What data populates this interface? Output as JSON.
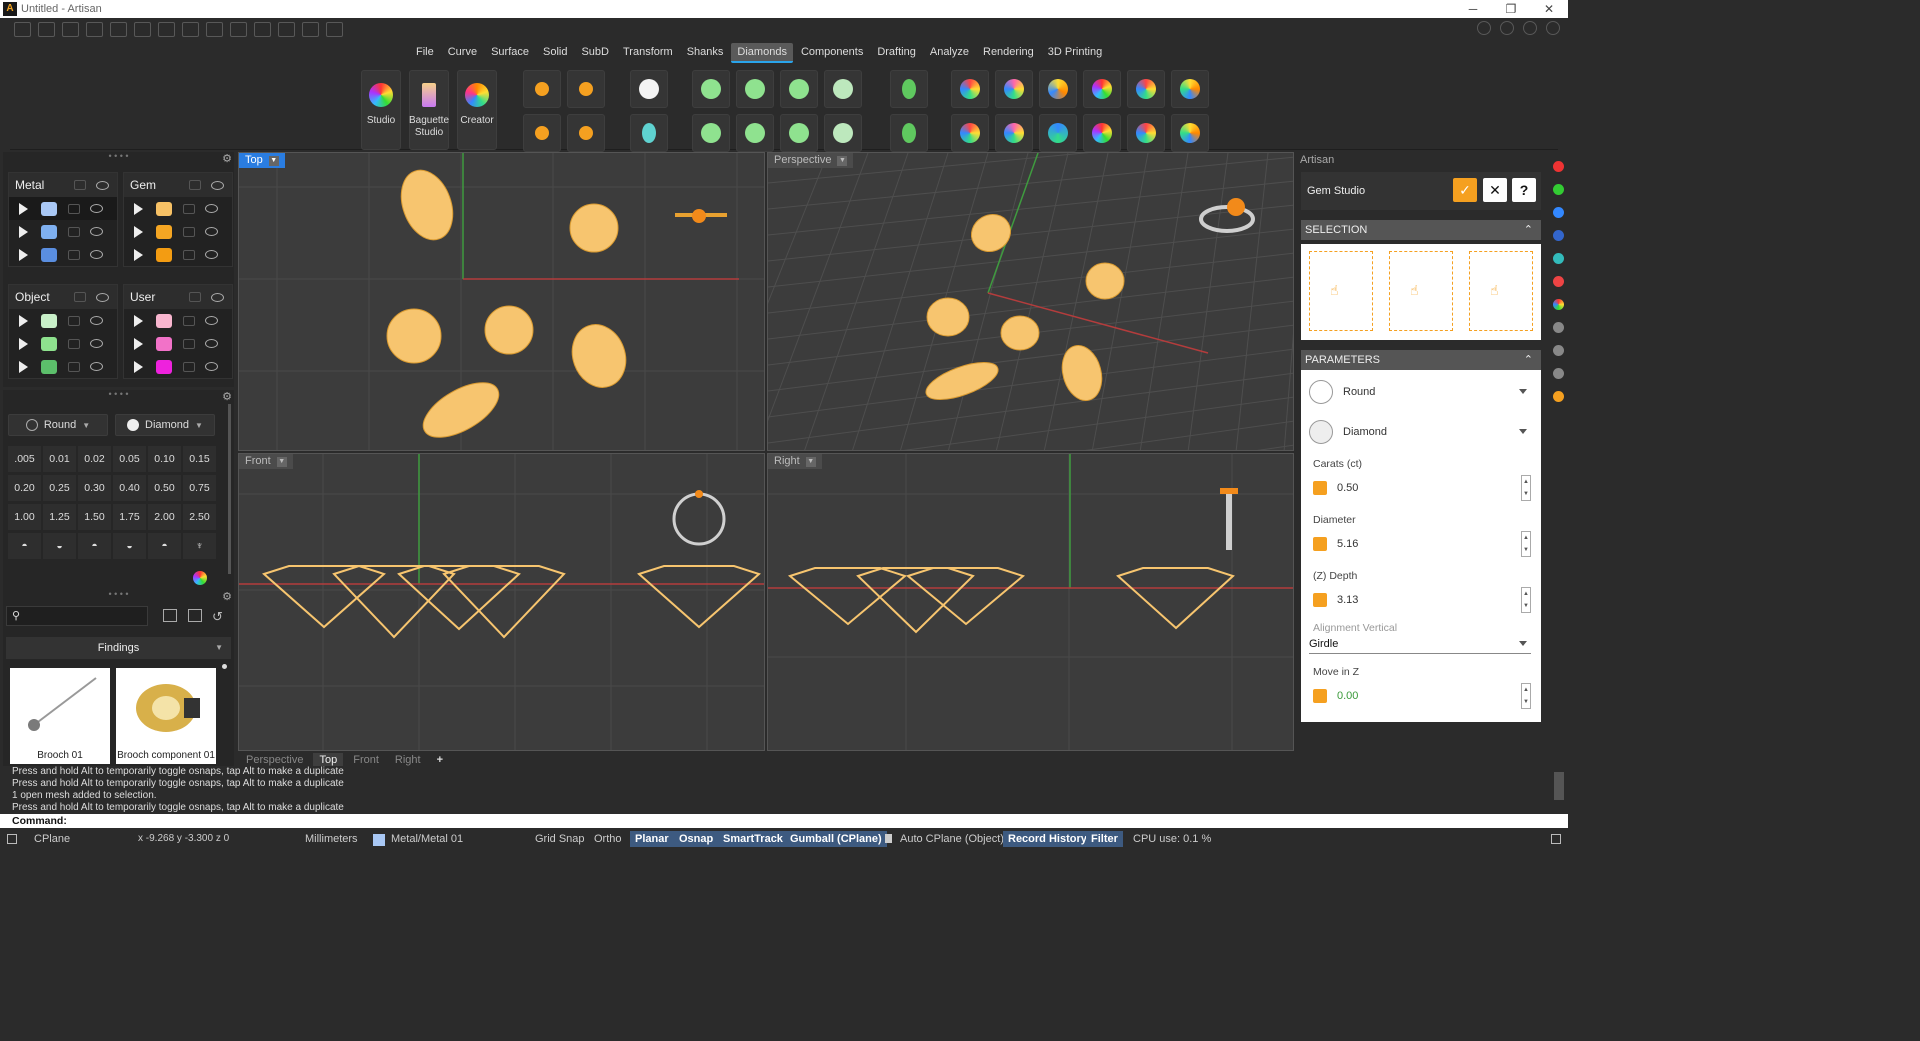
{
  "window": {
    "title": "Untitled - Artisan",
    "app_icon": "artisan-logo-icon"
  },
  "menu": {
    "items": [
      "File",
      "Curve",
      "Surface",
      "Solid",
      "SubD",
      "Transform",
      "Shanks",
      "Diamonds",
      "Components",
      "Drafting",
      "Analyze",
      "Rendering",
      "3D Printing"
    ],
    "active": "Diamonds"
  },
  "ribbon": {
    "big_buttons": [
      {
        "label": "Studio",
        "icon": "color-wheel-icon"
      },
      {
        "label": "Baguette Studio",
        "icon": "baguette-icon"
      },
      {
        "label": "Creator",
        "icon": "creator-icon"
      }
    ]
  },
  "layers": {
    "groups": [
      {
        "name": "Metal",
        "swatches": [
          "#a9c8f5",
          "#7fb0f0",
          "#5a8ee0"
        ]
      },
      {
        "name": "Gem",
        "swatches": [
          "#f7c165",
          "#f5a623",
          "#f39c12"
        ]
      },
      {
        "name": "Object",
        "swatches": [
          "#c9f0c9",
          "#8ee28e",
          "#5cbf6b"
        ]
      },
      {
        "name": "User",
        "swatches": [
          "#f9b6cf",
          "#f272c8",
          "#ee22dd"
        ]
      }
    ]
  },
  "gem_picker": {
    "shape": "Round",
    "material": "Diamond",
    "carats": [
      ".005",
      "0.01",
      "0.02",
      "0.05",
      "0.10",
      "0.15",
      "0.20",
      "0.25",
      "0.30",
      "0.40",
      "0.50",
      "0.75",
      "1.00",
      "1.25",
      "1.50",
      "1.75",
      "2.00",
      "2.50"
    ]
  },
  "library": {
    "search_placeholder": "",
    "category": "Findings",
    "items": [
      {
        "label": "Brooch 01"
      },
      {
        "label": "Brooch component 01"
      }
    ]
  },
  "viewports": {
    "top": "Top",
    "perspective": "Perspective",
    "front": "Front",
    "right": "Right",
    "tabs": [
      "Perspective",
      "Top",
      "Front",
      "Right"
    ],
    "active_tab": "Top",
    "add_tab": "+"
  },
  "artisan_panel": {
    "title": "Artisan",
    "tool": "Gem Studio",
    "confirm": "✓",
    "cancel": "✕",
    "help": "?",
    "selection_header": "SELECTION",
    "parameters_header": "PARAMETERS",
    "shape": "Round",
    "material": "Diamond",
    "carats_label": "Carats (ct)",
    "carats_value": "0.50",
    "diameter_label": "Diameter",
    "diameter_value": "5.16",
    "depth_label": "(Z) Depth",
    "depth_value": "3.13",
    "align_label": "Alignment Vertical",
    "align_value": "Girdle",
    "movez_label": "Move in Z",
    "movez_value": "0.00"
  },
  "command": {
    "log": [
      "Press and hold Alt to temporarily toggle osnaps, tap Alt to make a duplicate",
      "Press and hold Alt to temporarily toggle osnaps, tap Alt to make a duplicate",
      "1 open mesh added to selection.",
      "Press and hold Alt to temporarily toggle osnaps, tap Alt to make a duplicate"
    ],
    "prompt": "Command:"
  },
  "status": {
    "cplane": "CPlane",
    "coords": "x -9.268  y -3.300  z 0",
    "units": "Millimeters",
    "layer": "Metal/Metal 01",
    "grid_snap": "Grid Snap",
    "ortho": "Ortho",
    "planar": "Planar",
    "osnap": "Osnap",
    "smarttrack": "SmartTrack",
    "gumball": "Gumball (CPlane)",
    "auto_cplane": "Auto CPlane (Object)",
    "record_history": "Record History",
    "filter": "Filter",
    "cpu": "CPU use: 0.1 %"
  },
  "colors": {
    "accent": "#2a7de1",
    "gem": "#f7c56f",
    "orange": "#f5a020"
  }
}
